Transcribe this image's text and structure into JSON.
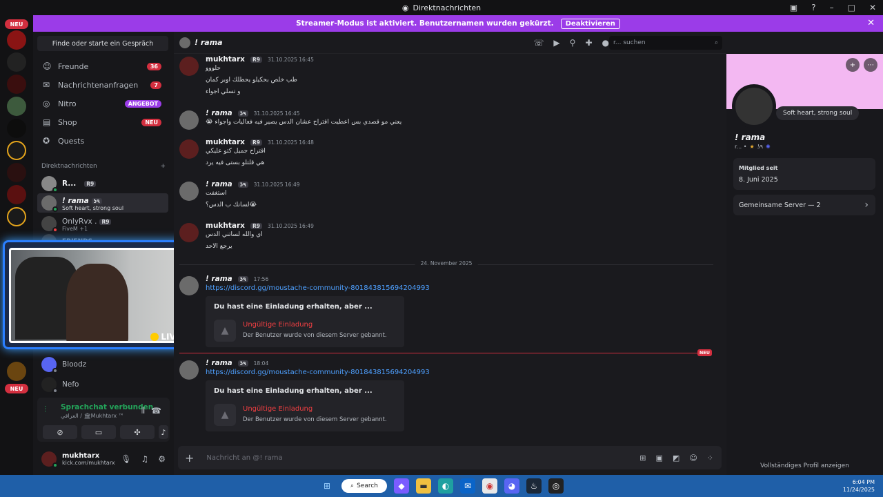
{
  "window": {
    "title": "Direktnachrichten"
  },
  "banner": {
    "text": "Streamer-Modus ist aktiviert. Benutzernamen wurden gekürzt.",
    "button": "Deaktivieren",
    "color": "#9b3ce8"
  },
  "rail": {
    "neu_top": "NEU",
    "neu_bottom": "NEU"
  },
  "dm_column": {
    "search_label": "Finde oder starte ein Gespräch",
    "nav": [
      {
        "label": "Freunde",
        "badge": "36",
        "icon": "friends-icon"
      },
      {
        "label": "Nachrichtenanfragen",
        "badge": "7",
        "icon": "mail-icon"
      },
      {
        "label": "Nitro",
        "badge": "ANGEBOT",
        "icon": "nitro-icon"
      },
      {
        "label": "Shop",
        "badge": "NEU",
        "icon": "shop-icon"
      },
      {
        "label": "Quests",
        "badge": "",
        "icon": "quests-icon"
      }
    ],
    "dm_header": "Direktnachrichten",
    "dms": [
      {
        "name": "R...",
        "tag": "R9",
        "sub": ""
      },
      {
        "name": "! rama",
        "tag": "ʖ٩",
        "sub": "Soft heart, strong soul"
      },
      {
        "name": "OnlyRvx .",
        "tag": "R9",
        "sub": "FiveM +1"
      },
      {
        "name": "FRIENDS",
        "tag": "",
        "sub": ""
      },
      {
        "name": "Bloodz",
        "tag": "",
        "sub": ""
      },
      {
        "name": "Nefo",
        "tag": "",
        "sub": ""
      }
    ],
    "live_label": "LIVE",
    "voice": {
      "status": "Sprachchat verbunden",
      "channel": "العراقي / 🏛Mukhtarx ™"
    },
    "user": {
      "name": "mukhtarx",
      "status": "kick.com/mukhtarx"
    }
  },
  "chat": {
    "header_name": "! rama",
    "search_placeholder": "r... suchen",
    "messages": [
      {
        "author": "mukhtarx",
        "tag": "R9",
        "time": "31.10.2025 16:45",
        "lines": [
          "حلووو",
          "طب خلص بحكيلو يحطلك اوبر كمان",
          "و تسلي اجواء"
        ]
      },
      {
        "author": "! rama",
        "tag": "ʖ٩",
        "time": "31.10.2025 16:45",
        "lines": [
          "يعني مو قصدي بس اعطيت اقتراح عشان الدس يصير فيه فعاليات واجواء 😭"
        ]
      },
      {
        "author": "mukhtarx",
        "tag": "R9",
        "time": "31.10.2025 16:48",
        "lines": [
          "اقتراح جميل كتو عليكي",
          "هي قلتلو بستى فيه يرد"
        ]
      },
      {
        "author": "! rama",
        "tag": "ʖ٩",
        "time": "31.10.2025 16:49",
        "lines": [
          "استغفت",
          "😭لسانك ب الدس؟"
        ]
      },
      {
        "author": "mukhtarx",
        "tag": "R9",
        "time": "31.10.2025 16:49",
        "lines": [
          "اي والله لساتني الدس",
          "يرجع الاحد"
        ]
      },
      {
        "author": "! rama",
        "tag": "ʖ٩",
        "time": "17:56",
        "link": "https://discord.gg/moustache-community-801843815694204993"
      },
      {
        "author": "! rama",
        "tag": "ʖ٩",
        "time": "18:04",
        "link": "https://discord.gg/moustache-community-801843815694204993"
      }
    ],
    "date_divider": "24. November 2025",
    "new_label": "NEU",
    "invite": {
      "title": "Du hast eine Einladung erhalten, aber ...",
      "status": "Ungültige Einladung",
      "desc": "Der Benutzer wurde von diesem Server gebannt."
    },
    "composer_placeholder": "Nachricht an @! rama"
  },
  "profile": {
    "name": "! rama",
    "sub": "r... •",
    "tag": "ʖ٩",
    "bio": "Soft heart, strong soul",
    "member_since_label": "Mitglied seit",
    "member_since": "8. Juni 2025",
    "mutual": "Gemeinsame Server — 2",
    "full_profile": "Vollständiges Profil anzeigen",
    "banner_color": "#f3b8f2"
  },
  "taskbar": {
    "search": "Search",
    "time": "6:04 PM",
    "date": "11/24/2025"
  }
}
